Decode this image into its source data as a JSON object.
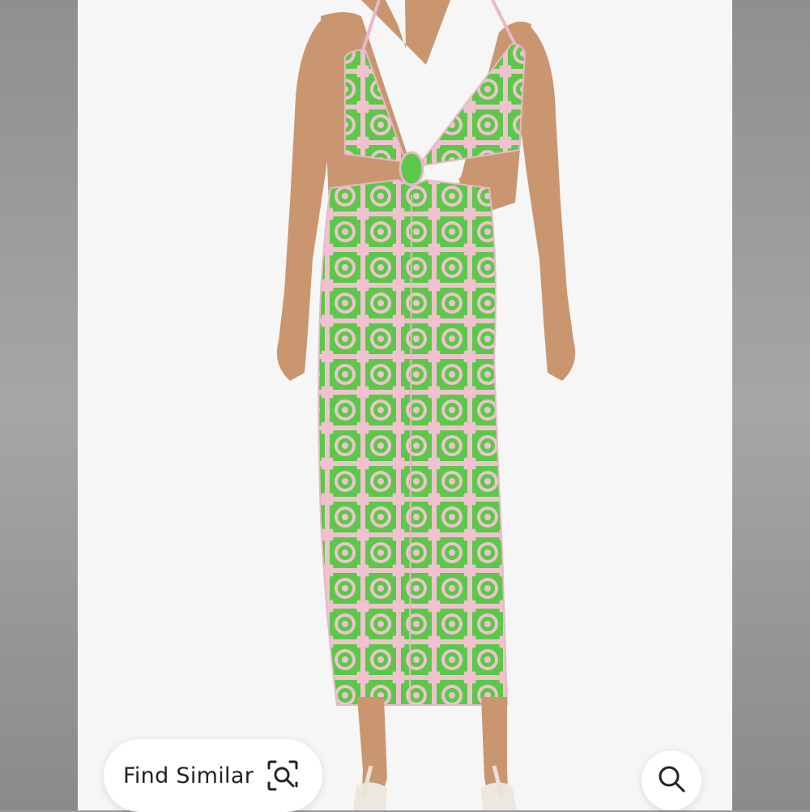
{
  "product_image": {
    "alt_subject": "green-and-pink-crochet-cutout-maxi-dress",
    "colors": {
      "background": "#f6f6f6",
      "side_panel": "#9a9a9a",
      "crochet_green": "#5cc84a",
      "crochet_pink": "#f0c2cf",
      "skin": "#c99670"
    }
  },
  "actions": {
    "find_similar_label": "Find Similar",
    "find_similar_icon": "visual-search-icon",
    "search_icon": "magnifier-icon"
  }
}
